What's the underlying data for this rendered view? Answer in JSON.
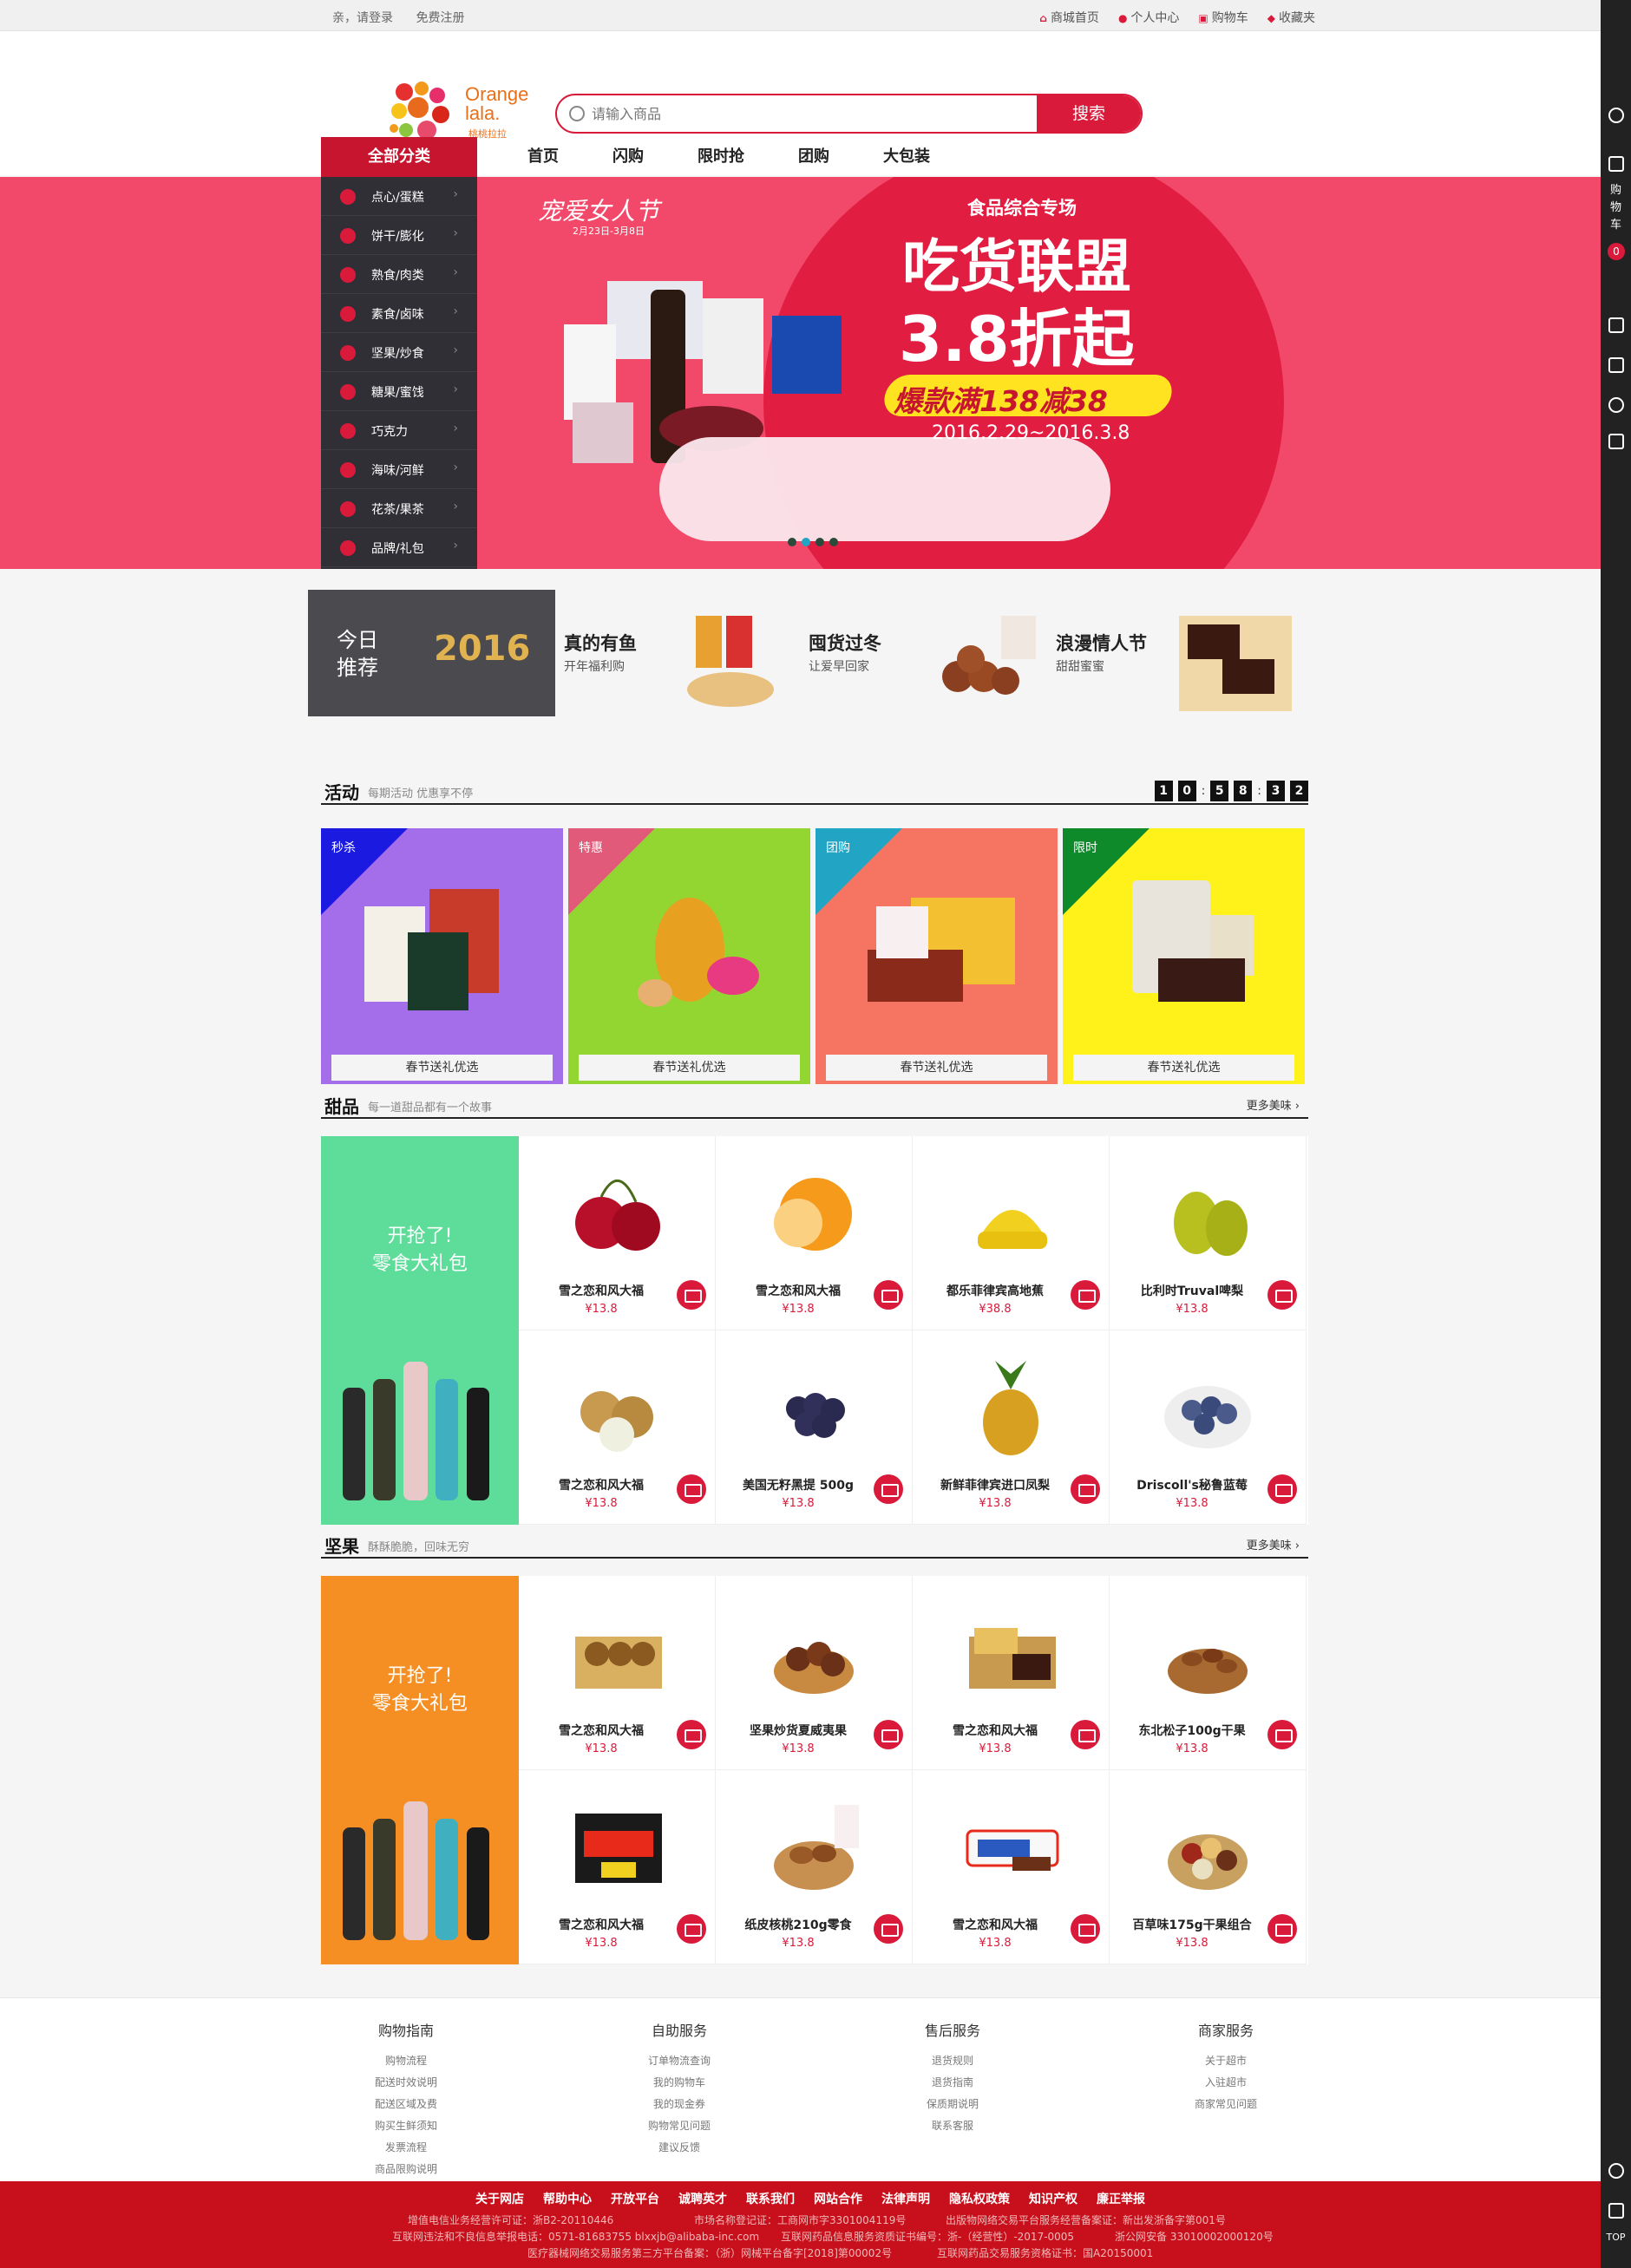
{
  "topbar": {
    "login": "亲，请登录",
    "register": "免费注册",
    "links": [
      "商城首页",
      "个人中心",
      "购物车",
      "收藏夹"
    ]
  },
  "logo": {
    "text1": "Orange",
    "text2": "lala.",
    "sub": "桃桃拉拉"
  },
  "search": {
    "placeholder": "请输入商品",
    "button": "搜索"
  },
  "nav": {
    "all": "全部分类",
    "links": [
      "首页",
      "闪购",
      "限时抢",
      "团购",
      "大包装"
    ]
  },
  "categories": [
    "点心/蛋糕",
    "饼干/膨化",
    "熟食/肉类",
    "素食/卤味",
    "坚果/炒食",
    "糖果/蜜饯",
    "巧克力",
    "海味/河鲜",
    "花茶/果茶",
    "品牌/礼包"
  ],
  "banner": {
    "festival": "宠爱女人节",
    "festival_date": "2月23日-3月8日",
    "small": "食品综合专场",
    "title": "吃货联盟",
    "sub": "3.8折起",
    "strip": "爆款满138减38",
    "date": "2016.2.29~2016.3.8"
  },
  "recommend": {
    "t1a": "今日",
    "t1b": "推荐",
    "year": "2016",
    "items": [
      {
        "title": "真的有鱼",
        "sub": "开年福利购"
      },
      {
        "title": "囤货过冬",
        "sub": "让爱早回家"
      },
      {
        "title": "浪漫情人节",
        "sub": "甜甜蜜蜜"
      }
    ]
  },
  "activity": {
    "title": "活动",
    "sub": "每期活动 优惠享不停",
    "countdown": [
      "1",
      "0",
      "5",
      "8",
      "3",
      "2"
    ],
    "cards": [
      {
        "tag": "秒杀",
        "bar": "春节送礼优选",
        "color": "#a46de9",
        "tagcolor": "#1a1ae0"
      },
      {
        "tag": "特惠",
        "bar": "春节送礼优选",
        "color": "#93d631",
        "tagcolor": "#e25a7a"
      },
      {
        "tag": "团购",
        "bar": "春节送礼优选",
        "color": "#f57462",
        "tagcolor": "#22a4c5"
      },
      {
        "tag": "限时",
        "bar": "春节送礼优选",
        "color": "#fff21a",
        "tagcolor": "#0e8a2a"
      }
    ]
  },
  "sweets": {
    "title": "甜品",
    "sub": "每一道甜品都有一个故事",
    "more": "更多美味",
    "promo": "开抢了!",
    "promo2": "零食大礼包",
    "products": [
      {
        "name": "雪之恋和风大福",
        "price": "¥13.8"
      },
      {
        "name": "雪之恋和风大福",
        "price": "¥13.8"
      },
      {
        "name": "都乐菲律宾高地蕉",
        "price": "¥38.8"
      },
      {
        "name": "比利时Truval啤梨",
        "price": "¥13.8"
      },
      {
        "name": "雪之恋和风大福",
        "price": "¥13.8"
      },
      {
        "name": "美国无籽黑提 500g",
        "price": "¥13.8"
      },
      {
        "name": "新鲜菲律宾进口凤梨",
        "price": "¥13.8"
      },
      {
        "name": "Driscoll's秘鲁蓝莓",
        "price": "¥13.8"
      }
    ]
  },
  "nuts": {
    "title": "坚果",
    "sub": "酥酥脆脆，回味无穷",
    "more": "更多美味",
    "promo": "开抢了!",
    "promo2": "零食大礼包",
    "products": [
      {
        "name": "雪之恋和风大福",
        "price": "¥13.8"
      },
      {
        "name": "坚果炒货夏威夷果",
        "price": "¥13.8"
      },
      {
        "name": "雪之恋和风大福",
        "price": "¥13.8"
      },
      {
        "name": "东北松子100g干果",
        "price": "¥13.8"
      },
      {
        "name": "雪之恋和风大福",
        "price": "¥13.8"
      },
      {
        "name": "纸皮核桃210g零食",
        "price": "¥13.8"
      },
      {
        "name": "雪之恋和风大福",
        "price": "¥13.8"
      },
      {
        "name": "百草味175g干果组合",
        "price": "¥13.8"
      }
    ]
  },
  "footer": {
    "cols": [
      {
        "head": "购物指南",
        "items": [
          "购物流程",
          "配送时效说明",
          "配送区域及费",
          "购买生鲜须知",
          "发票流程",
          "商品限购说明"
        ]
      },
      {
        "head": "自助服务",
        "items": [
          "订单物流查询",
          "我的购物车",
          "我的现金券",
          "购物常见问题",
          "建议反馈"
        ]
      },
      {
        "head": "售后服务",
        "items": [
          "退货规则",
          "退货指南",
          "保质期说明",
          "联系客服"
        ]
      },
      {
        "head": "商家服务",
        "items": [
          "关于超市",
          "入驻超市",
          "商家常见问题"
        ]
      }
    ],
    "links": [
      "关于网店",
      "帮助中心",
      "开放平台",
      "诚聘英才",
      "联系我们",
      "网站合作",
      "法律声明",
      "隐私权政策",
      "知识产权",
      "廉正举报"
    ],
    "info1": "增值电信业务经营许可证：浙B2-20110446",
    "info2": "市场名称登记证：工商网市字3301004119号",
    "info3": "出版物网络交易平台服务经营备案证：新出发浙备字第001号",
    "info4": "互联网违法和不良信息举报电话：0571-81683755 blxxjb@alibaba-inc.com",
    "info5": "互联网药品信息服务资质证书编号：浙-（经营性）-2017-0005",
    "info6": "浙公网安备 33010002000120号",
    "info7": "医疗器械网络交易服务第三方平台备案：（浙）网械平台备字[2018]第00002号",
    "info8": "互联网药品交易服务资格证书：国A20150001"
  },
  "sidebar": {
    "cart": "购物车",
    "count": "0",
    "top": "TOP"
  }
}
